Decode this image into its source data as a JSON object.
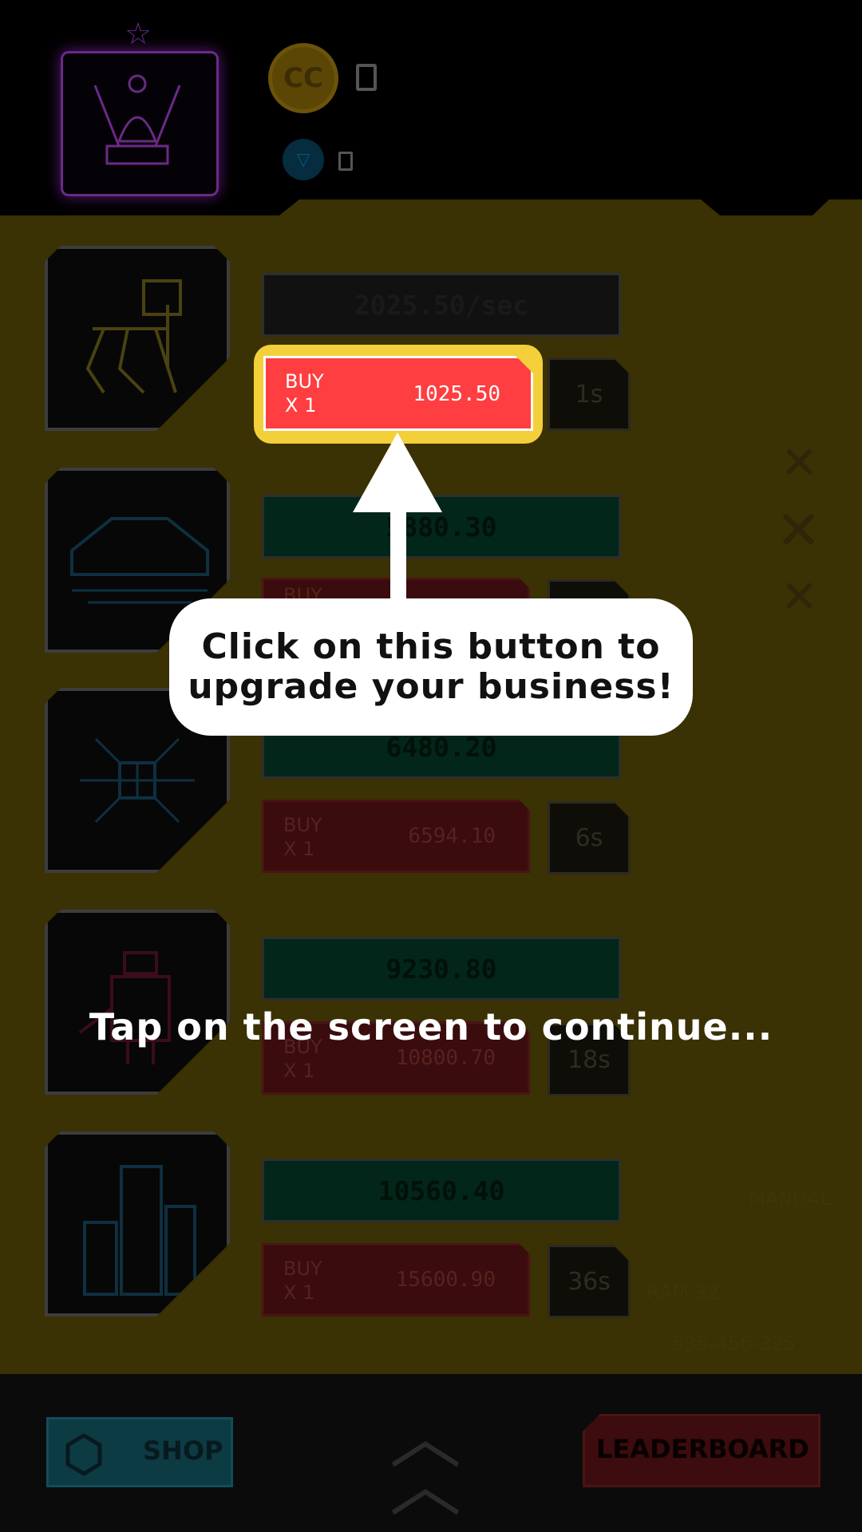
{
  "header": {
    "coin_label": "CC"
  },
  "businesses": [
    {
      "rate": "2025.50/sec",
      "buy_label": "BUY\nX 1",
      "price": "1025.50",
      "timer": "1s",
      "rate_style": "dark",
      "highlighted": true
    },
    {
      "rate": "5880.30",
      "buy_label": "BUY",
      "price": "",
      "timer": "",
      "rate_style": "green",
      "highlighted": false
    },
    {
      "rate": "6480.20",
      "buy_label": "BUY\nX 1",
      "price": "6594.10",
      "timer": "6s",
      "rate_style": "green",
      "highlighted": false
    },
    {
      "rate": "9230.80",
      "buy_label": "BUY\nX 1",
      "price": "10800.70",
      "timer": "18s",
      "rate_style": "green",
      "highlighted": false
    },
    {
      "rate": "10560.40",
      "buy_label": "BUY\nX 1",
      "price": "15600.90",
      "timer": "36s",
      "rate_style": "green",
      "highlighted": false
    }
  ],
  "tutorial": {
    "line1": "Click on this button to",
    "line2": "upgrade your business!",
    "tap_prompt": "Tap on the screen to continue..."
  },
  "decor": {
    "manual": "MANUAL",
    "ram": "RAM 32",
    "serial": "535-456-325"
  },
  "bottom_nav": {
    "shop_label": "SHOP",
    "leaderboard_label": "LEADERBOARD"
  },
  "colors": {
    "panel": "#3a3104",
    "highlight": "#f3d03a",
    "buy_active": "#ff3e41"
  }
}
